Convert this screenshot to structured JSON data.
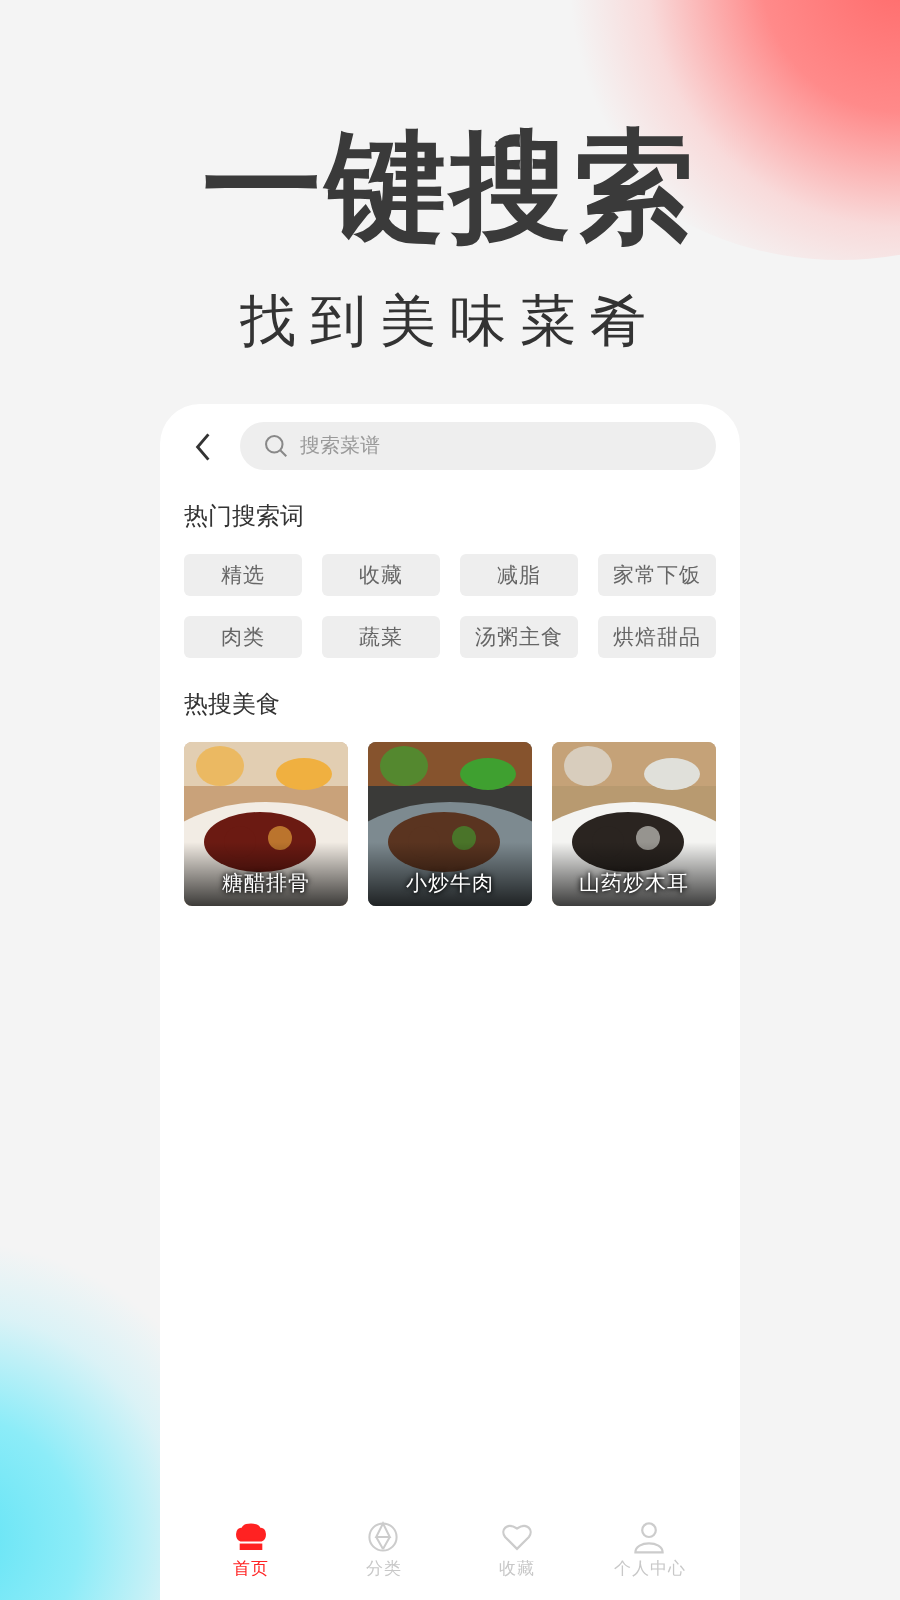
{
  "headline": "一键搜索",
  "subheadline": "找到美味菜肴",
  "search": {
    "placeholder": "搜索菜谱"
  },
  "hot_terms": {
    "title": "热门搜索词",
    "tags": [
      "精选",
      "收藏",
      "减脂",
      "家常下饭",
      "肉类",
      "蔬菜",
      "汤粥主食",
      "烘焙甜品"
    ]
  },
  "hot_food": {
    "title": "热搜美食",
    "items": [
      {
        "name": "糖醋排骨",
        "kind": "picture"
      },
      {
        "name": "小炒牛肉",
        "kind": "picture"
      },
      {
        "name": "山药炒木耳",
        "kind": "picture"
      }
    ]
  },
  "tab_bar": [
    {
      "label": "首页",
      "selected": true
    },
    {
      "label": "分类",
      "selected": false
    },
    {
      "label": "收藏",
      "selected": false
    },
    {
      "label": "个人中心",
      "selected": false
    }
  ]
}
